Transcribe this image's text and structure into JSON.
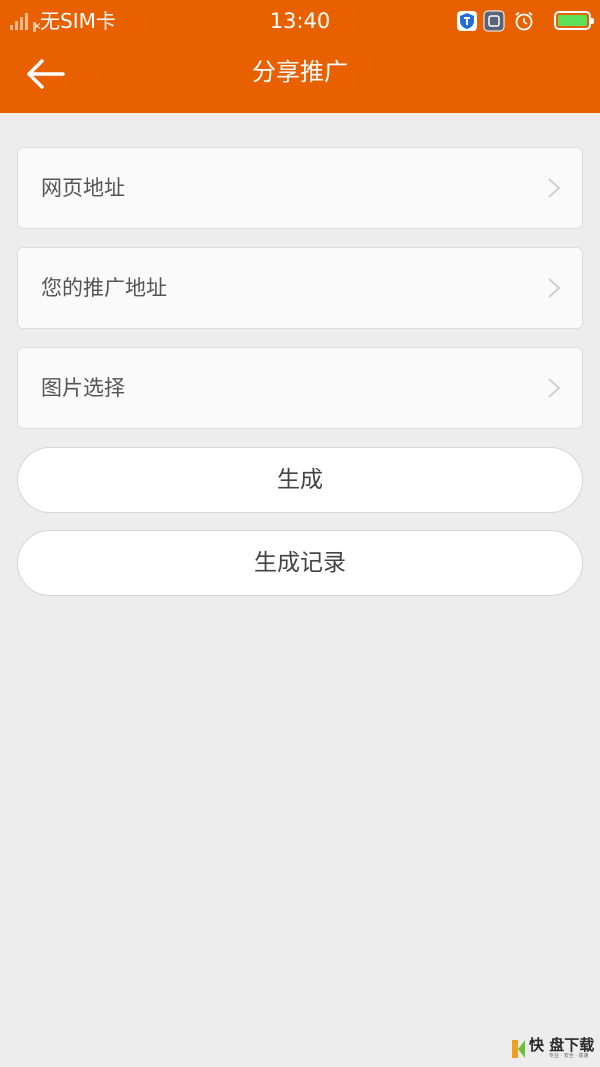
{
  "status_bar": {
    "carrier": "无SIM卡",
    "time": "13:40"
  },
  "header": {
    "title": "分享推广",
    "back_icon": "arrow-left-icon",
    "background": "#e96000"
  },
  "menu": {
    "items": [
      {
        "label": "网页地址",
        "icon": "chevron-right-icon"
      },
      {
        "label": "您的推广地址",
        "icon": "chevron-right-icon"
      },
      {
        "label": "图片选择",
        "icon": "chevron-right-icon"
      }
    ]
  },
  "actions": {
    "generate_label": "生成",
    "history_label": "生成记录"
  },
  "watermark": {
    "main": "快 盘下载",
    "sub": "专业 · 安全 · 高速"
  }
}
